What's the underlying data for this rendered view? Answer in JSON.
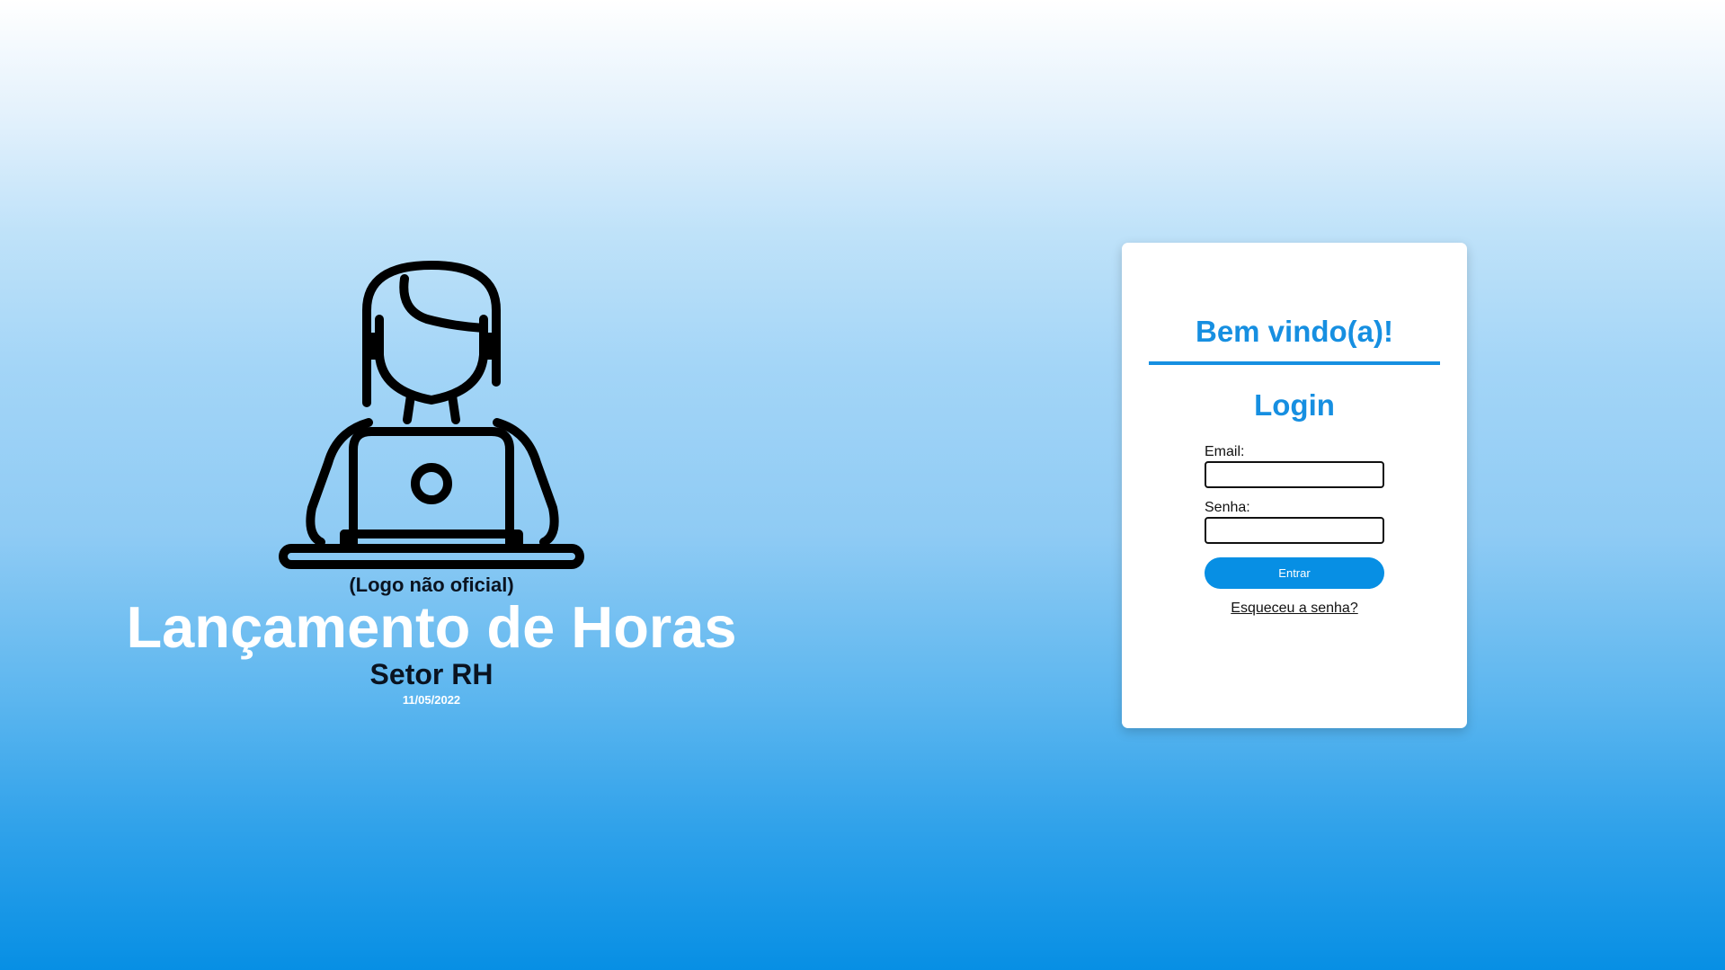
{
  "hero": {
    "logo_icon": "woman-at-laptop-icon",
    "logo_caption": "(Logo não oficial)",
    "title": "Lançamento de Horas",
    "subtitle": "Setor RH",
    "date": "11/05/2022"
  },
  "login_card": {
    "welcome": "Bem vindo(a)!",
    "title": "Login",
    "email_label": "Email:",
    "email_value": "",
    "password_label": "Senha:",
    "password_value": "",
    "submit_label": "Entrar",
    "forgot_link": "Esqueceu a senha?"
  },
  "colors": {
    "accent": "#168fe1",
    "button": "#078fe4",
    "gradient_bottom": "#078fe4"
  }
}
